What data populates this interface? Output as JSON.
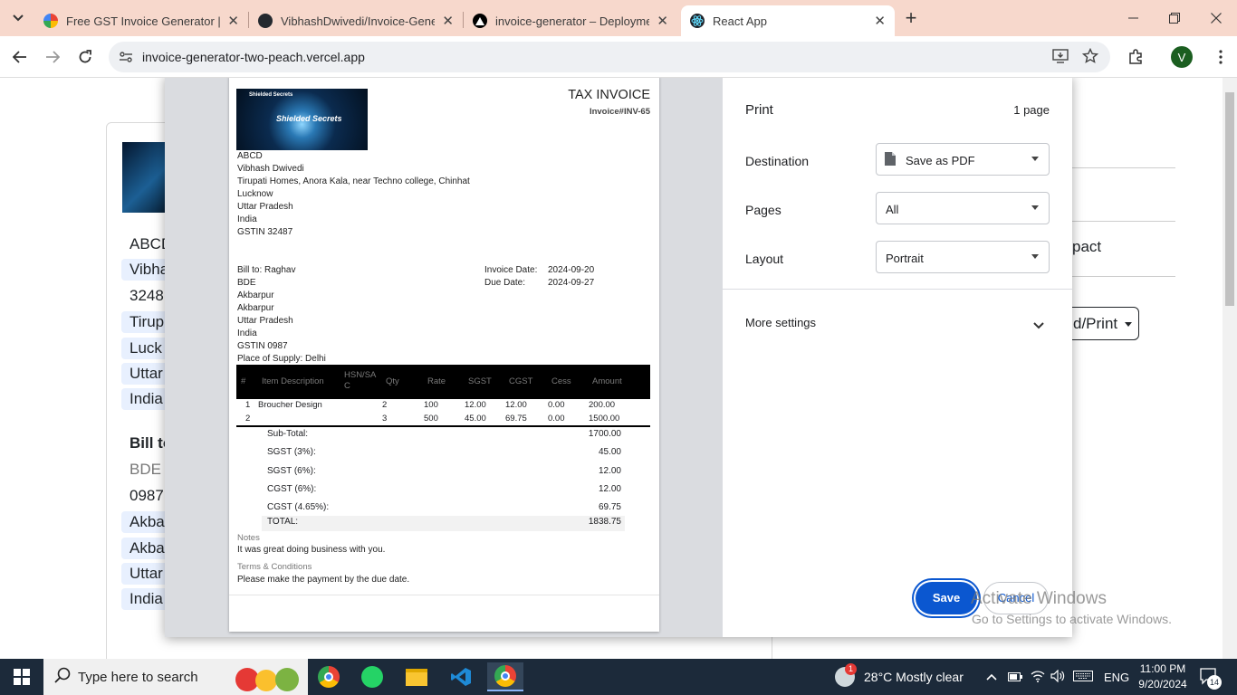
{
  "browser": {
    "tabs": [
      {
        "title": "Free GST Invoice Generator | Fre",
        "active": false
      },
      {
        "title": "VibhashDwivedi/Invoice-Genera",
        "active": false
      },
      {
        "title": "invoice-generator – Deploymen",
        "active": false
      },
      {
        "title": "React App",
        "active": true
      }
    ],
    "close_glyph": "✕",
    "new_tab_glyph": "+",
    "url": "invoice-generator-two-peach.vercel.app",
    "profile_initial": "V"
  },
  "app_background": {
    "rows": [
      "ABCD",
      "Vibhash",
      "3248",
      "Tirup",
      "Luck",
      "Uttar",
      "India"
    ],
    "bill_to_heading": "Bill to",
    "bill_rows": [
      "BDE",
      "0987",
      "Akba",
      "Akba",
      "Uttar",
      "India"
    ],
    "right_partial": "pact",
    "download_button": "d/Print"
  },
  "invoice": {
    "title": "TAX INVOICE",
    "number": "Invoice#INV-65",
    "logo_text": "Shielded Secrets",
    "logo_caption": "Shielded Secrets",
    "seller": [
      "ABCD",
      "Vibhash Dwivedi",
      "Tirupati Homes, Anora Kala, near Techno college, Chinhat",
      "Lucknow",
      "Uttar Pradesh",
      "India",
      "GSTIN 32487"
    ],
    "bill_to": [
      "Bill to: Raghav",
      "BDE",
      "Akbarpur",
      "Akbarpur",
      "Uttar Pradesh",
      "India",
      "GSTIN 0987",
      "Place of Supply: Delhi"
    ],
    "invoice_date_label": "Invoice Date:",
    "invoice_date": "2024-09-20",
    "due_date_label": "Due Date:",
    "due_date": "2024-09-27",
    "columns": [
      "#",
      "Item Description",
      "HSN/SA\nC",
      "Qty",
      "Rate",
      "SGST",
      "CGST",
      "Cess",
      "Amount"
    ],
    "items": [
      [
        "1",
        "Broucher Design",
        "",
        "2",
        "100",
        "12.00",
        "12.00",
        "0.00",
        "200.00"
      ],
      [
        "2",
        "",
        "",
        "3",
        "500",
        "45.00",
        "69.75",
        "0.00",
        "1500.00"
      ]
    ],
    "totals": [
      {
        "label": "Sub-Total:",
        "value": "1700.00"
      },
      {
        "label": "SGST (3%):",
        "value": "45.00"
      },
      {
        "label": "SGST (6%):",
        "value": "12.00"
      },
      {
        "label": "CGST (6%):",
        "value": "12.00"
      },
      {
        "label": "CGST (4.65%):",
        "value": "69.75"
      },
      {
        "label": "TOTAL:",
        "value": "1838.75"
      }
    ],
    "notes_label": "Notes",
    "notes": "It was great doing business with you.",
    "terms_label": "Terms & Conditions",
    "terms": "Please make the payment by the due date."
  },
  "print_dialog": {
    "title": "Print",
    "page_count": "1 page",
    "destination_label": "Destination",
    "destination_value": "Save as PDF",
    "pages_label": "Pages",
    "pages_value": "All",
    "layout_label": "Layout",
    "layout_value": "Portrait",
    "more_settings": "More settings",
    "save": "Save",
    "cancel": "Cancel"
  },
  "watermark": {
    "line1": "Activate Windows",
    "line2": "Go to Settings to activate Windows."
  },
  "taskbar": {
    "search_placeholder": "Type here to search",
    "weather": "28°C  Mostly clear",
    "language": "ENG",
    "time": "11:00 PM",
    "date": "9/20/2024",
    "notification_count": "14",
    "weather_badge": "1"
  }
}
